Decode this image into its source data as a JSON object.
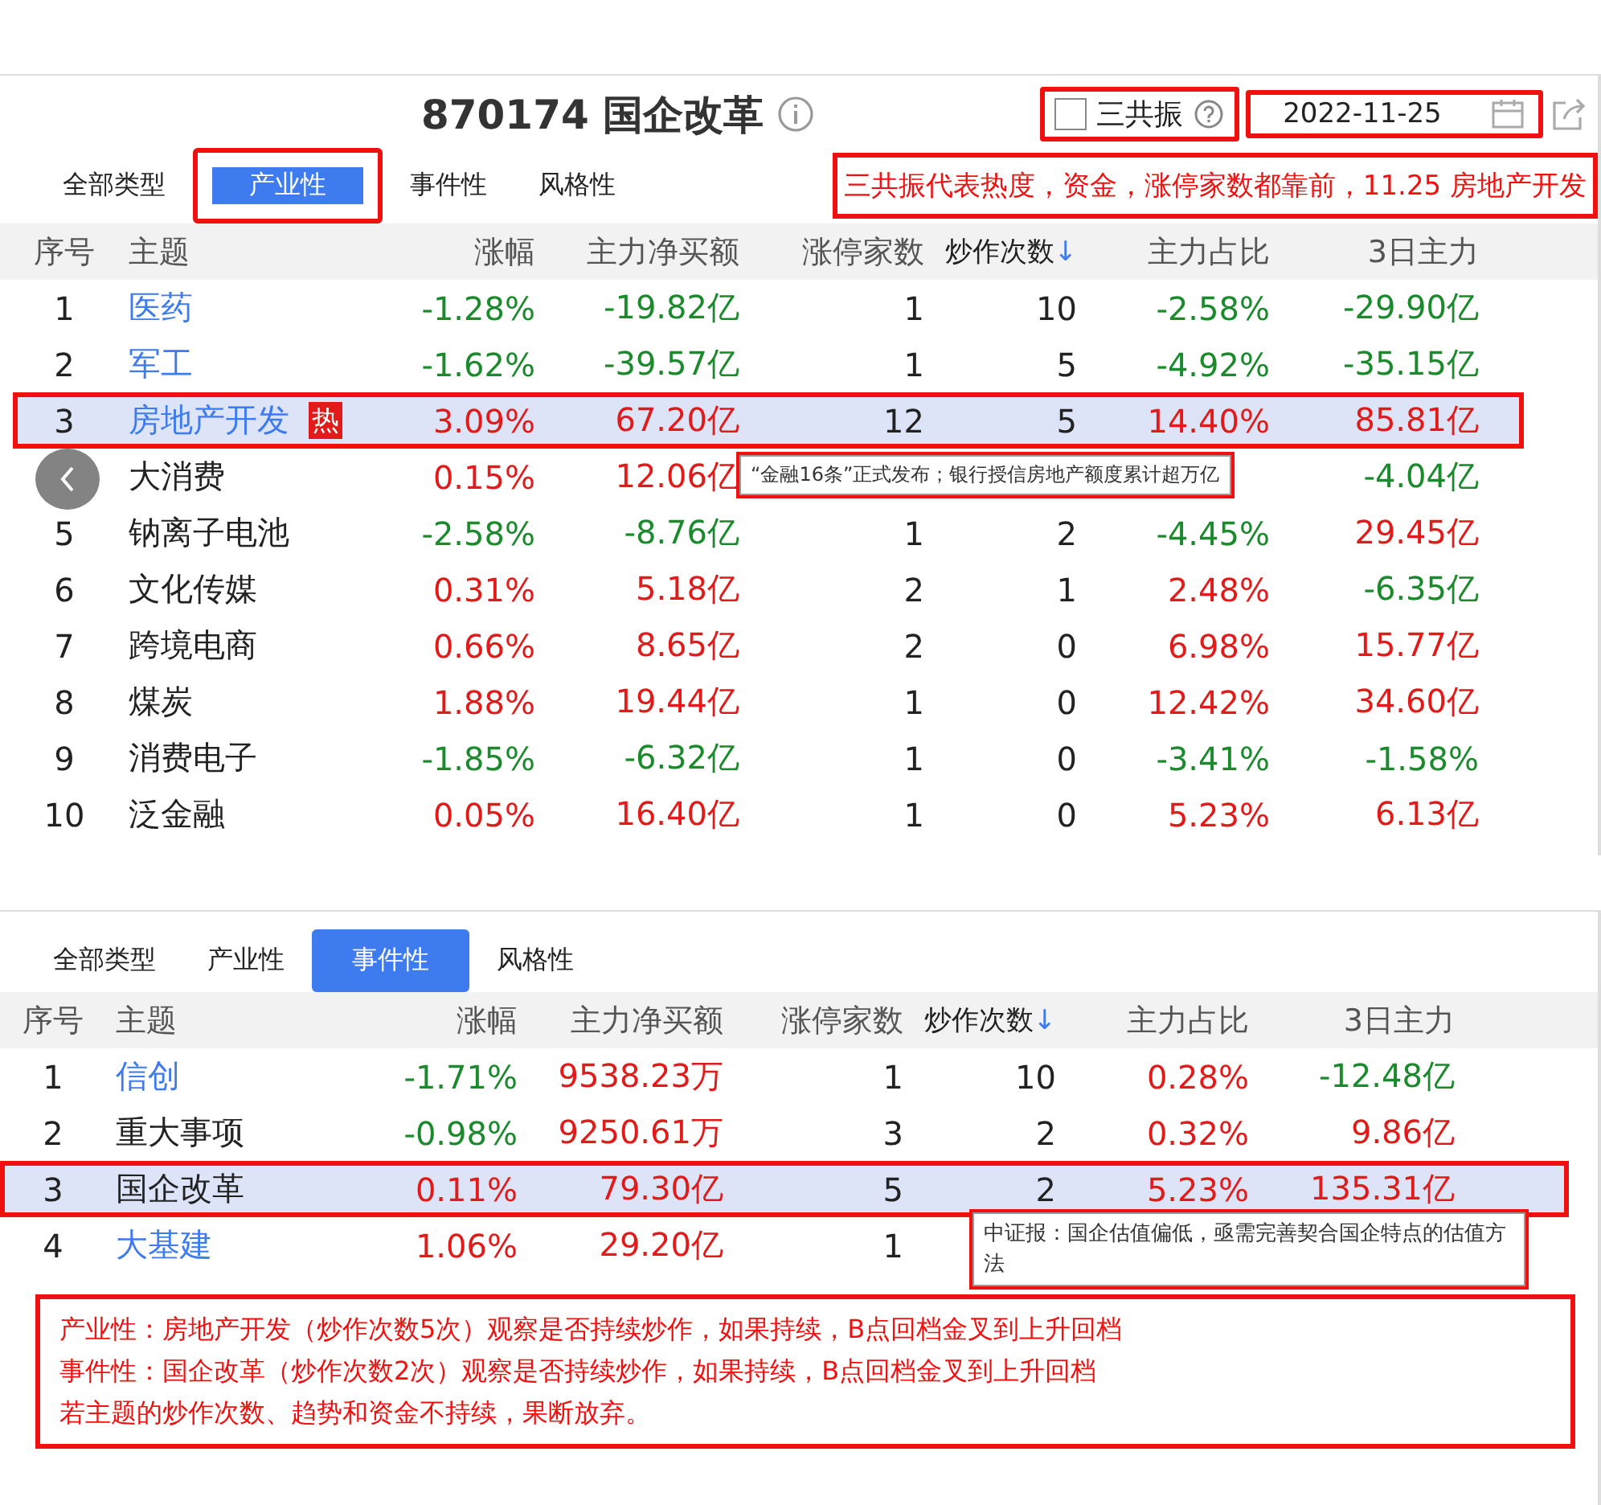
{
  "top_panel": {
    "title": "870174 国企改革",
    "resonance": {
      "label": "三共振",
      "checked": false,
      "annotated": true
    },
    "date": {
      "value": "2022-11-25",
      "annotated": true
    },
    "tabs": [
      {
        "label": "全部类型",
        "selected": false,
        "annotated": false
      },
      {
        "label": "产业性",
        "selected": true,
        "annotated": true
      },
      {
        "label": "事件性",
        "selected": false,
        "annotated": false
      },
      {
        "label": "风格性",
        "selected": false,
        "annotated": false
      }
    ],
    "note": "三共振代表热度，资金，涨停家数都靠前，11.25 房地产开发",
    "columns": [
      "序号",
      "主题",
      "涨幅",
      "主力净买额",
      "涨停家数",
      "炒作次数",
      "主力占比",
      "3日主力"
    ],
    "sort_indicator": "↓",
    "rows": [
      {
        "no": "1",
        "name": "医药",
        "link": true,
        "hot": false,
        "highlighted": false,
        "change": {
          "text": "-1.28%",
          "up": false
        },
        "net_buy": {
          "text": "-19.82亿",
          "up": false
        },
        "limit_up": "1",
        "hype": "10",
        "ratio": {
          "text": "-2.58%",
          "up": false
        },
        "three_day": {
          "text": "-29.90亿",
          "up": false
        }
      },
      {
        "no": "2",
        "name": "军工",
        "link": true,
        "hot": false,
        "highlighted": false,
        "change": {
          "text": "-1.62%",
          "up": false
        },
        "net_buy": {
          "text": "-39.57亿",
          "up": false
        },
        "limit_up": "1",
        "hype": "5",
        "ratio": {
          "text": "-4.92%",
          "up": false
        },
        "three_day": {
          "text": "-35.15亿",
          "up": false
        }
      },
      {
        "no": "3",
        "name": "房地产开发",
        "link": true,
        "hot": true,
        "highlighted": true,
        "change": {
          "text": "3.09%",
          "up": true
        },
        "net_buy": {
          "text": "67.20亿",
          "up": true
        },
        "limit_up": "12",
        "hype": "5",
        "ratio": {
          "text": "14.40%",
          "up": true
        },
        "three_day": {
          "text": "85.81亿",
          "up": true
        }
      },
      {
        "name": "大消费",
        "link": false,
        "hot": false,
        "highlighted": false,
        "change": {
          "text": "0.15%",
          "up": true
        },
        "net_buy": {
          "text": "12.06亿",
          "up": true
        },
        "three_day": {
          "text": "-4.04亿",
          "up": false
        },
        "tooltip": "“金融16条”正式发布；银行授信房地产额度累计超万亿"
      },
      {
        "no": "5",
        "name": "钠离子电池",
        "link": false,
        "hot": false,
        "highlighted": false,
        "change": {
          "text": "-2.58%",
          "up": false
        },
        "net_buy": {
          "text": "-8.76亿",
          "up": false
        },
        "limit_up": "1",
        "hype": "2",
        "ratio": {
          "text": "-4.45%",
          "up": false
        },
        "three_day": {
          "text": "29.45亿",
          "up": true
        }
      },
      {
        "no": "6",
        "name": "文化传媒",
        "link": false,
        "hot": false,
        "highlighted": false,
        "change": {
          "text": "0.31%",
          "up": true
        },
        "net_buy": {
          "text": "5.18亿",
          "up": true
        },
        "limit_up": "2",
        "hype": "1",
        "ratio": {
          "text": "2.48%",
          "up": true
        },
        "three_day": {
          "text": "-6.35亿",
          "up": false
        }
      },
      {
        "no": "7",
        "name": "跨境电商",
        "link": false,
        "hot": false,
        "highlighted": false,
        "change": {
          "text": "0.66%",
          "up": true
        },
        "net_buy": {
          "text": "8.65亿",
          "up": true
        },
        "limit_up": "2",
        "hype": "0",
        "ratio": {
          "text": "6.98%",
          "up": true
        },
        "three_day": {
          "text": "15.77亿",
          "up": true
        }
      },
      {
        "no": "8",
        "name": "煤炭",
        "link": false,
        "hot": false,
        "highlighted": false,
        "change": {
          "text": "1.88%",
          "up": true
        },
        "net_buy": {
          "text": "19.44亿",
          "up": true
        },
        "limit_up": "1",
        "hype": "0",
        "ratio": {
          "text": "12.42%",
          "up": true
        },
        "three_day": {
          "text": "34.60亿",
          "up": true
        }
      },
      {
        "no": "9",
        "name": "消费电子",
        "link": false,
        "hot": false,
        "highlighted": false,
        "change": {
          "text": "-1.85%",
          "up": false
        },
        "net_buy": {
          "text": "-6.32亿",
          "up": false
        },
        "limit_up": "1",
        "hype": "0",
        "ratio": {
          "text": "-3.41%",
          "up": false
        },
        "three_day": {
          "text": "-1.58%",
          "up": false
        }
      },
      {
        "no": "10",
        "name": "泛金融",
        "link": false,
        "hot": false,
        "highlighted": false,
        "change": {
          "text": "0.05%",
          "up": true
        },
        "net_buy": {
          "text": "16.40亿",
          "up": true
        },
        "limit_up": "1",
        "hype": "0",
        "ratio": {
          "text": "5.23%",
          "up": true
        },
        "three_day": {
          "text": "6.13亿",
          "up": true
        }
      }
    ]
  },
  "bottom_panel": {
    "tabs": [
      {
        "label": "全部类型",
        "selected": false,
        "annotated": false
      },
      {
        "label": "产业性",
        "selected": false,
        "annotated": false
      },
      {
        "label": "事件性",
        "selected": true,
        "annotated": false
      },
      {
        "label": "风格性",
        "selected": false,
        "annotated": false
      }
    ],
    "columns": [
      "序号",
      "主题",
      "涨幅",
      "主力净买额",
      "涨停家数",
      "炒作次数",
      "主力占比",
      "3日主力"
    ],
    "sort_indicator": "↓",
    "rows": [
      {
        "no": "1",
        "name": "信创",
        "link": true,
        "hot": false,
        "highlighted": false,
        "change": {
          "text": "-1.71%",
          "up": false
        },
        "net_buy": {
          "text": "9538.23万",
          "up": true
        },
        "limit_up": "1",
        "hype": "10",
        "ratio": {
          "text": "0.28%",
          "up": true
        },
        "three_day": {
          "text": "-12.48亿",
          "up": false
        }
      },
      {
        "no": "2",
        "name": "重大事项",
        "link": false,
        "hot": false,
        "highlighted": false,
        "change": {
          "text": "-0.98%",
          "up": false
        },
        "net_buy": {
          "text": "9250.61万",
          "up": true
        },
        "limit_up": "3",
        "hype": "2",
        "ratio": {
          "text": "0.32%",
          "up": true
        },
        "three_day": {
          "text": "9.86亿",
          "up": true
        }
      },
      {
        "no": "3",
        "name": "国企改革",
        "link": false,
        "hot": false,
        "highlighted": true,
        "change": {
          "text": "0.11%",
          "up": true
        },
        "net_buy": {
          "text": "79.30亿",
          "up": true
        },
        "limit_up": "5",
        "hype": "2",
        "ratio": {
          "text": "5.23%",
          "up": true
        },
        "three_day": {
          "text": "135.31亿",
          "up": true
        }
      },
      {
        "no": "4",
        "name": "大基建",
        "link": true,
        "hot": false,
        "highlighted": false,
        "change": {
          "text": "1.06%",
          "up": true
        },
        "net_buy": {
          "text": "29.20亿",
          "up": true
        },
        "limit_up": "1",
        "tooltip": "中证报：国企估值偏低，亟需完善契合国企特点的估值方法"
      }
    ]
  },
  "hot_label": "热",
  "notes": [
    "产业性：房地产开发（炒作次数5次）观察是否持续炒作，如果持续，B点回档金叉到上升回档",
    "事件性：国企改革（炒作次数2次）观察是否持续炒作，如果持续，B点回档金叉到上升回档",
    "若主题的炒作次数、趋势和资金不持续，果断放弃。"
  ]
}
